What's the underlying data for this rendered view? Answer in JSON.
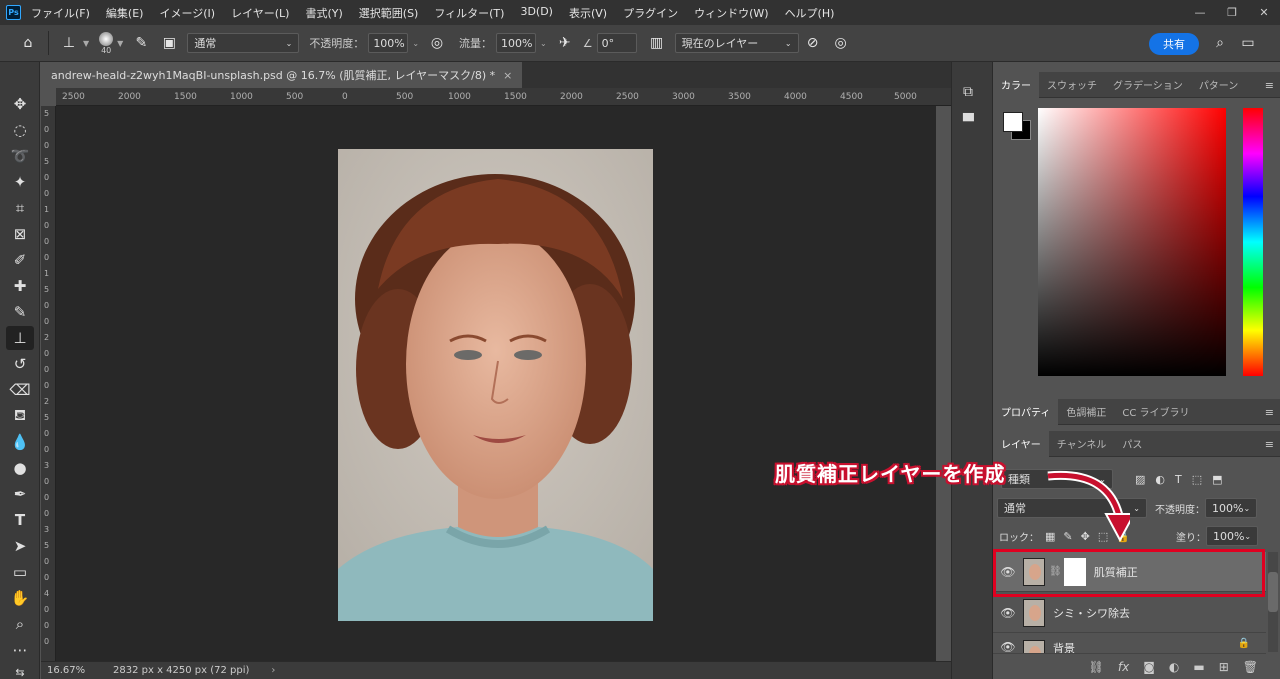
{
  "menubar": {
    "logo": "Ps",
    "items": [
      "ファイル(F)",
      "編集(E)",
      "イメージ(I)",
      "レイヤー(L)",
      "書式(Y)",
      "選択範囲(S)",
      "フィルター(T)",
      "3D(D)",
      "表示(V)",
      "プラグイン",
      "ウィンドウ(W)",
      "ヘルプ(H)"
    ]
  },
  "options": {
    "brush_size": "40",
    "mode": "通常",
    "opacity_label": "不透明度：",
    "opacity": "100%",
    "flow_label": "流量：",
    "flow": "100%",
    "angle": "0°",
    "sample": "現在のレイヤー",
    "share": "共有"
  },
  "document": {
    "tab_title": "andrew-heald-z2wyh1MaqBI-unsplash.psd @ 16.7% (肌質補正, レイヤーマスク/8) *",
    "ruler_top": [
      "2500",
      "2000",
      "1500",
      "1000",
      "500",
      "0",
      "500",
      "1000",
      "1500",
      "2000",
      "2500",
      "3000",
      "3500",
      "4000",
      "4500",
      "5000"
    ],
    "ruler_left": [
      "5",
      "0",
      "0",
      "5",
      "0",
      "0",
      "1",
      "0",
      "0",
      "0",
      "1",
      "5",
      "0",
      "0",
      "2",
      "0",
      "0",
      "0",
      "2",
      "5",
      "0",
      "0",
      "3",
      "0",
      "0",
      "0",
      "3",
      "5",
      "0",
      "0",
      "4",
      "0",
      "0",
      "0"
    ]
  },
  "status": {
    "zoom": "16.67%",
    "dimensions": "2832 px x 4250 px (72 ppi)"
  },
  "color_panel": {
    "tabs": [
      "カラー",
      "スウォッチ",
      "グラデーション",
      "パターン"
    ]
  },
  "properties_panel": {
    "tabs": [
      "プロパティ",
      "色調補正",
      "CC ライブラリ"
    ]
  },
  "layers_panel": {
    "tabs": [
      "レイヤー",
      "チャンネル",
      "パス"
    ],
    "kind_filter": "種類",
    "blend_mode": "通常",
    "opacity_label": "不透明度：",
    "opacity": "100%",
    "lock_label": "ロック：",
    "fill_label": "塗り：",
    "fill": "100%",
    "layers": [
      {
        "name": "肌質補正"
      },
      {
        "name": "シミ・シワ除去"
      },
      {
        "name": "背景"
      }
    ]
  },
  "annotation": {
    "text": "肌質補正レイヤーを作成",
    "color": "#c8102e"
  },
  "colors": {
    "accent": "#1473e6",
    "highlight_box": "#e00020"
  }
}
